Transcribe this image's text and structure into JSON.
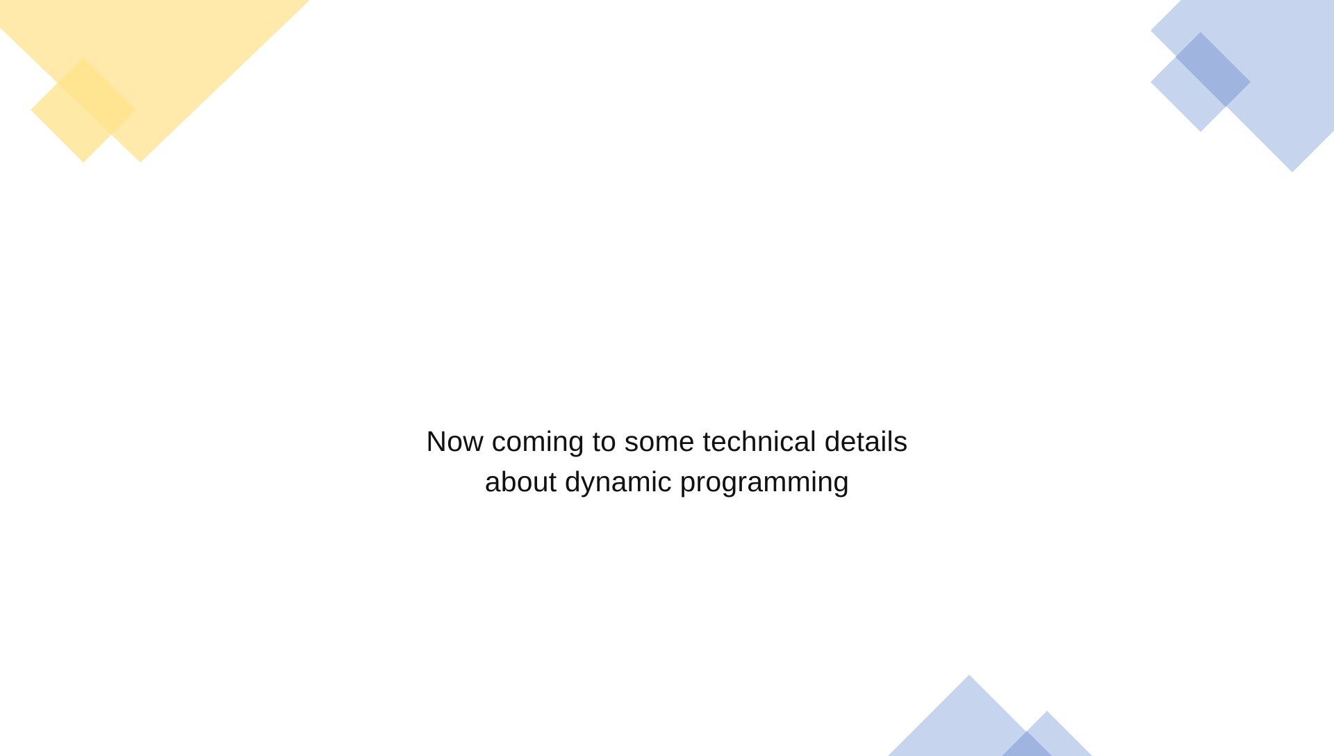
{
  "slide": {
    "text_lines": [
      "Now coming to some technical details",
      "about dynamic programming"
    ]
  },
  "colors": {
    "background": "#ffffff",
    "text": "#111111",
    "yellow_light": "#ffe9a8",
    "yellow_mid": "#ffe189",
    "yellow_dark": "#ffd966",
    "blue_light": "#c6d4ee",
    "blue_dark": "#9fb5e0"
  }
}
